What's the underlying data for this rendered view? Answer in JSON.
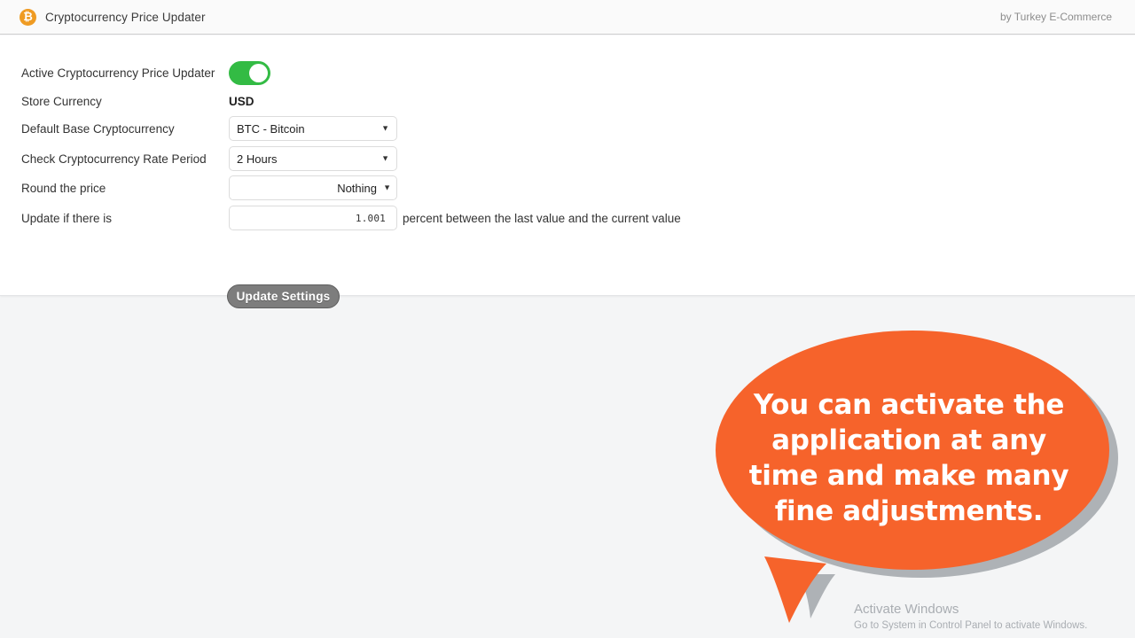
{
  "header": {
    "logo_icon": "bitcoin-icon",
    "logo_glyph": "₿",
    "title": "Cryptocurrency Price Updater",
    "byline": "by Turkey E-Commerce"
  },
  "form": {
    "rows": [
      {
        "label": "Active Cryptocurrency Price Updater",
        "type": "toggle",
        "value": "on"
      },
      {
        "label": "Store Currency",
        "type": "static",
        "value": "USD"
      },
      {
        "label": "Default Base Cryptocurrency",
        "type": "select",
        "value": "BTC - Bitcoin",
        "options": [
          "BTC - Bitcoin"
        ]
      },
      {
        "label": "Check Cryptocurrency Rate Period",
        "type": "select",
        "value": "2 Hours",
        "options": [
          "2 Hours"
        ]
      },
      {
        "label": "Round the price",
        "type": "select",
        "value": "Nothing",
        "options": [
          "Nothing"
        ]
      },
      {
        "label": "Update if there is",
        "type": "number",
        "value": "1.001",
        "suffix": "percent between the last value and the current value"
      }
    ],
    "submit_label": "Update Settings"
  },
  "callout": {
    "text": "You can activate the application at any time and make many fine adjustments.",
    "bubble_color": "#f6632b",
    "shadow_color": "#aeb2b6",
    "text_color": "#ffffff"
  },
  "watermark": {
    "title": "Activate Windows",
    "subtitle": "Go to System in Control Panel to activate Windows."
  }
}
